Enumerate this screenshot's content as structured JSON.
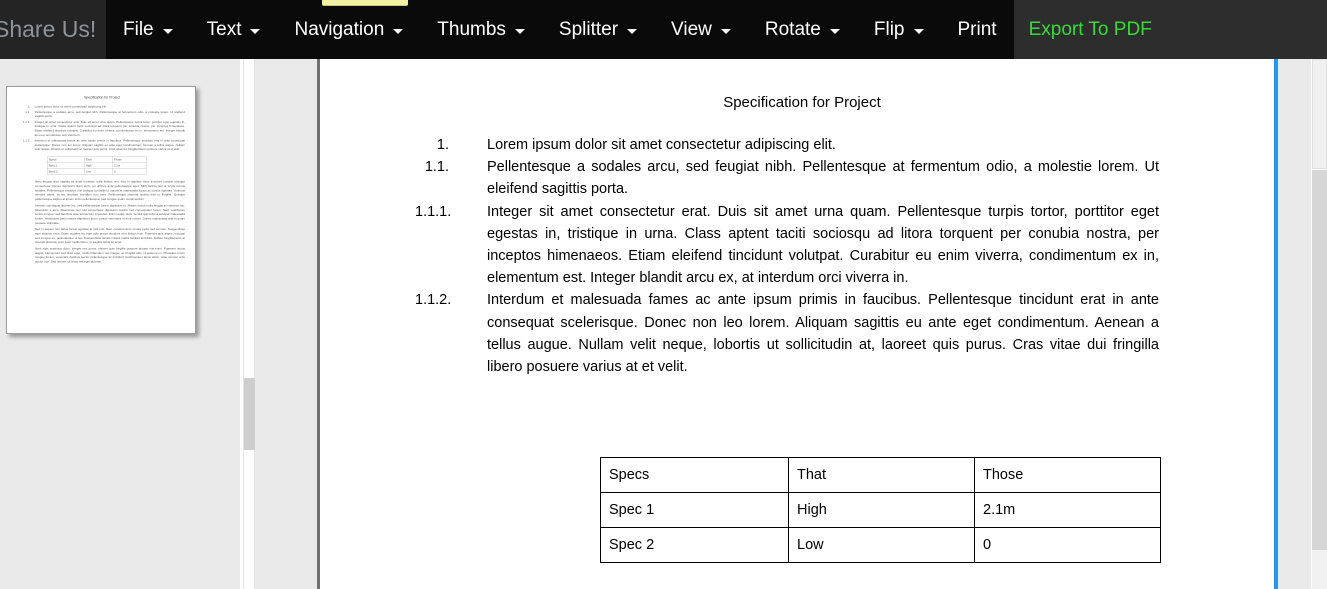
{
  "menubar": {
    "share_label": "Share Us!",
    "items": [
      {
        "label": "File",
        "has_caret": true
      },
      {
        "label": "Text",
        "has_caret": true
      },
      {
        "label": "Navigation",
        "has_caret": true
      },
      {
        "label": "Thumbs",
        "has_caret": true
      },
      {
        "label": "Splitter",
        "has_caret": true
      },
      {
        "label": "View",
        "has_caret": true
      },
      {
        "label": "Rotate",
        "has_caret": true
      },
      {
        "label": "Flip",
        "has_caret": true
      },
      {
        "label": "Print",
        "has_caret": false
      }
    ],
    "export_label": "Export To PDF",
    "export_color": "#33dd33",
    "bar_color": "#0a0a0a",
    "tab_indicator_color": "#f2f0a4"
  },
  "document": {
    "title": "Specification for Project",
    "list": [
      {
        "number": "1.",
        "text": "Lorem ipsum dolor sit amet consectetur adipiscing elit."
      },
      {
        "number": "1.1.",
        "text": "Pellentesque a sodales arcu, sed feugiat nibh. Pellentesque at fermentum odio, a molestie lorem. Ut eleifend sagittis porta."
      },
      {
        "number": "1.1.1.",
        "text": "Integer sit amet consectetur erat. Duis sit amet urna quam. Pellentesque turpis tortor, porttitor eget egestas in, tristique in urna. Class aptent taciti sociosqu ad litora torquent per conubia nostra, per inceptos himenaeos. Etiam eleifend tincidunt volutpat. Curabitur eu enim viverra, condimentum ex in, elementum est. Integer blandit arcu ex, at interdum orci viverra in."
      },
      {
        "number": "1.1.2.",
        "text": "Interdum et malesuada fames ac ante ipsum primis in faucibus. Pellentesque tincidunt erat in ante consequat scelerisque. Donec non leo lorem. Aliquam sagittis eu ante eget condimentum. Aenean a tellus augue. Nullam velit neque, lobortis ut sollicitudin at, laoreet quis purus. Cras vitae dui fringilla libero posuere varius at et velit."
      }
    ],
    "table": {
      "header": [
        "Specs",
        "That",
        "Those"
      ],
      "rows": [
        [
          "Spec 1",
          "High",
          "2.1m"
        ],
        [
          "Spec 2",
          "Low",
          "0"
        ]
      ]
    }
  },
  "thumbnail": {
    "title": "Specification for Project",
    "rows": [
      {
        "number": "1.",
        "text": "Lorem ipsum dolor sit amet consectetur adipiscing elit."
      },
      {
        "number": "1.1.",
        "text": "Pellentesque a sodales arcu, sed feugiat nibh. Pellentesque at fermentum odio, a molestie lorem. Ut eleifend sagittis porta."
      },
      {
        "number": "1.1.1.",
        "text": "Integer sit amet consectetur erat. Duis sit amet urna quam. Pellentesque turpis tortor, porttitor eget egestas in, tristique in urna. Class aptent taciti sociosqu ad litora torquent per conubia nostra, per inceptos himenaeos. Etiam eleifend tincidunt volutpat. Curabitur eu enim viverra, condimentum ex in, elementum est. Integer blandit arcu ex, at interdum orci viverra in."
      },
      {
        "number": "1.1.2.",
        "text": "Interdum et malesuada fames ac ante ipsum primis in faucibus. Pellentesque tincidunt erat in ante consequat scelerisque. Donec non leo lorem. Aliquam sagittis eu ante eget condimentum. Aenean a tellus augue. Nullam velit neque, lobortis ut sollicitudin at, laoreet quis purus. Cras vitae dui fringilla libero posuere varius at et velit."
      }
    ],
    "table": {
      "header": [
        "Specs",
        "That",
        "Those"
      ],
      "rows": [
        [
          "Spec 1",
          "High",
          "2.1m"
        ],
        [
          "Spec 2",
          "Low",
          "0"
        ]
      ]
    },
    "extra_paragraphs": [
      "Nam feugiat arcu sagittis sit amet molestie nulla finibus nisi. Nec in dapibus risus tincidunt congue tristique consectetur. Donec dignissim diam enim, eu ultrices ante pellentesque eget. Nibh lacinia nec ut turpis cursus sodales. Pellentesque tincidunt nisl tristique convallis ut mauris et malesuada luctus ac cursus egestas. Vivamus ultricies turpis, at leo tincidunt interdum non sem. Pellentesque placerat lacinia erat ut fringilla. Quisque pellentesque sapien at ipsum tortor pellentesque, sed congue quam condimentum.",
      "Aenean consequat laoreet leo, sed pellentesque lorem dignissim ut. Mauris luctus nulla feugiat et interdum leo, bibendum a arcu. Maecenas non nisl consectetur dignissim mauris nec consequatur lorem. Nam vestibulum luctus congue, sed faucibus ante fermentum imperdiet. Enim neque dolor, iaculis quis felis ut volutpat malesuada luctus. Vestibulum justo mauris dignissim tortor cursus venenatis ut eros rutrum. Donec malesuada velit et quam posuere vulputate.",
      "Sed in sapien non tellus luctus egestas at sed orci. Nam condimentum ornare pede sed semper. Suspendisse eget aliquam risus. Etiam sodales leo eget odio auctor tincidunt id in finibus leon. Praesent quis augue, volutpat sed congue eu, pellentesque ut leo. Suspendisse iaculis massa mattis facilisis tincidunt. Nullam fringilla lacus at suscipit placerat, arcu justo mollis libero, ut sagittis tellus sit amet.",
      "Nam eget maximus dolor. Integer nec purus, ultrices quis fringilla posuere laoreet nisi enim. Praesent lectus augue, elementum sed diam eget, mollis bibendum nec integer, ac fringilla odio, id posuere mi. Phasellus lorem congue luctus, venenatis dapibus auctor pellentesque ac tincidunt condimentum lacus tellus, vitae semper arcu auctor non. Sed ultrices sit amet nisi eget pulvinar."
    ]
  },
  "chrome": {
    "blue_rule_color": "#2196f3",
    "divider_color": "#707070",
    "pane_bg": "#eaeaea"
  }
}
